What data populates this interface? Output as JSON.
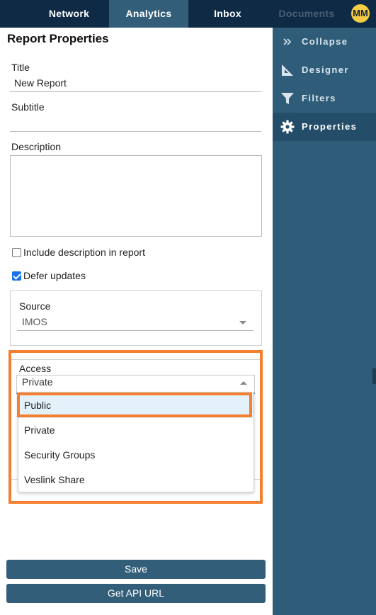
{
  "topnav": {
    "tabs": [
      {
        "label": "Network",
        "state": "normal"
      },
      {
        "label": "Analytics",
        "state": "active"
      },
      {
        "label": "Inbox",
        "state": "normal"
      },
      {
        "label": "Documents",
        "state": "disabled"
      }
    ],
    "avatar_initials": "MM"
  },
  "panel": {
    "title": "Report Properties",
    "title_field": {
      "label": "Title",
      "value": "New Report"
    },
    "subtitle_field": {
      "label": "Subtitle",
      "value": ""
    },
    "description_field": {
      "label": "Description",
      "value": ""
    },
    "include_description": {
      "label": "Include description in report",
      "checked": false
    },
    "defer_updates": {
      "label": "Defer updates",
      "checked": true
    },
    "source": {
      "label": "Source",
      "value": "IMOS"
    },
    "access": {
      "label": "Access",
      "value": "Private",
      "options": [
        "Public",
        "Private",
        "Security Groups",
        "Veslink Share"
      ],
      "highlighted_option": "Public"
    },
    "buttons": {
      "save": "Save",
      "api": "Get API URL"
    }
  },
  "sidebar": {
    "items": [
      {
        "label": "Collapse",
        "icon": "double-chevron-right-icon",
        "active": false
      },
      {
        "label": "Designer",
        "icon": "set-square-icon",
        "active": false
      },
      {
        "label": "Filters",
        "icon": "funnel-icon",
        "active": false
      },
      {
        "label": "Properties",
        "icon": "gear-icon",
        "active": true
      }
    ]
  },
  "colors": {
    "nav_bg": "#0e2a45",
    "nav_active": "#335e7a",
    "sidebar_bg": "#2f5d79",
    "sidebar_active": "#234d68",
    "button_bg": "#335e7a",
    "avatar_bg": "#f4cc46",
    "annotation_orange": "#f47f30",
    "option_hover": "#e3f1fb"
  }
}
